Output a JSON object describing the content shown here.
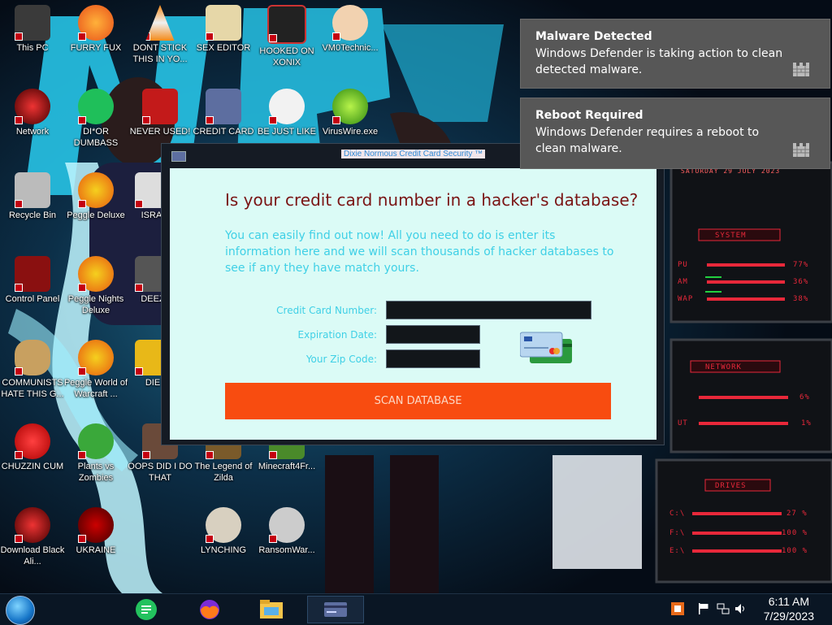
{
  "desktop_icons": [
    {
      "label": "This PC",
      "icon": "computer-icon"
    },
    {
      "label": "FURRY FUX",
      "icon": "firefox-icon"
    },
    {
      "label": "DONT STICK THIS IN YO...",
      "icon": "traffic-cone-icon"
    },
    {
      "label": "SEX EDITOR",
      "icon": "hex-editor-icon"
    },
    {
      "label": "HOOKED ON XONIX",
      "icon": "xonix-game-icon"
    },
    {
      "label": "VM0Technic...",
      "icon": "doctor-icon"
    },
    {
      "label": "Network",
      "icon": "network-orb-icon"
    },
    {
      "label": "DI*OR DUMBASS",
      "icon": "discord-icon"
    },
    {
      "label": "NEVER USED!",
      "icon": "devcpp-icon"
    },
    {
      "label": "CREDIT CARD",
      "icon": "credit-card-icon"
    },
    {
      "label": "BE JUST LIKE",
      "icon": "santa-icon"
    },
    {
      "label": "VirusWire.exe",
      "icon": "limewire-icon"
    },
    {
      "label": "Recycle Bin",
      "icon": "recycle-bin-icon"
    },
    {
      "label": "Peggle Deluxe",
      "icon": "peggle-icon"
    },
    {
      "label": "ISRAI",
      "icon": "israel-icon"
    },
    {
      "label": "Control Panel",
      "icon": "control-panel-icon"
    },
    {
      "label": "Peggle Nights Deluxe",
      "icon": "peggle-icon"
    },
    {
      "label": "DEEZ",
      "icon": "printer-icon"
    },
    {
      "label": "COMMUNISTS HATE THIS G...",
      "icon": "money-bag-icon"
    },
    {
      "label": "Peggle World of Warcraft ...",
      "icon": "peggle-icon"
    },
    {
      "label": "DIE",
      "icon": "die-icon"
    },
    {
      "label": "CHUZZIN CUM",
      "icon": "chuzzle-icon"
    },
    {
      "label": "Plants vs Zombies",
      "icon": "plant-icon"
    },
    {
      "label": "OOPS DID I DO THAT",
      "icon": "person-icon"
    },
    {
      "label": "The Legend of Zilda",
      "icon": "zelda-icon"
    },
    {
      "label": "Minecraft4Fr...",
      "icon": "minecraft-icon"
    },
    {
      "label": "Download Black Ali...",
      "icon": "network-orb-icon"
    },
    {
      "label": "UKRAINE",
      "icon": "radiation-icon"
    },
    {
      "label": "LYNCHING",
      "icon": "noose-icon"
    },
    {
      "label": "RansomWar...",
      "icon": "skull-icon"
    }
  ],
  "notifications": [
    {
      "title": "Malware Detected",
      "body": "Windows Defender is taking action to clean detected malware."
    },
    {
      "title": "Reboot Required",
      "body": "Windows Defender requires a reboot to clean malware."
    }
  ],
  "window": {
    "title": "Dixie Normous Credit Card Security ™",
    "heading": "Is your credit card number in a hacker's database?",
    "description": "You can easily find out now! All you need to do is enter its information here and we will scan thousands of hacker databases to see if any they have match yours.",
    "fields": {
      "card_number_label": "Credit Card Number:",
      "card_number_value": "",
      "expiration_label": "Expiration Date:",
      "expiration_value": "",
      "zip_label": "Your Zip Code:",
      "zip_value": ""
    },
    "scan_button": "SCAN DATABASE"
  },
  "rainmeter": {
    "date": "SATURDAY 29 JULY 2023",
    "system_title": "SYSTEM",
    "cpu_label": "PU",
    "cpu_value": "77%",
    "ram_label": "AM",
    "ram_value": "36%",
    "swap_label": "WAP",
    "swap_value": "38%",
    "network_title": "NETWORK",
    "net_in_value": "6%",
    "net_out_label": "UT",
    "net_out_value": "1%",
    "drives_title": "DRIVES",
    "drives": [
      {
        "label": "C:\\",
        "value": "27 %"
      },
      {
        "label": "F:\\",
        "value": "100 %"
      },
      {
        "label": "E:\\",
        "value": "100 %"
      }
    ]
  },
  "taskbar": {
    "pinned": [
      "discord-icon",
      "firefox-icon",
      "file-explorer-icon",
      "credit-card-app-icon"
    ],
    "tray": [
      "office-icon",
      "flag-icon",
      "action-center-flag-icon",
      "network-icon",
      "volume-icon"
    ],
    "time": "6:11 AM",
    "date": "7/29/2023"
  }
}
